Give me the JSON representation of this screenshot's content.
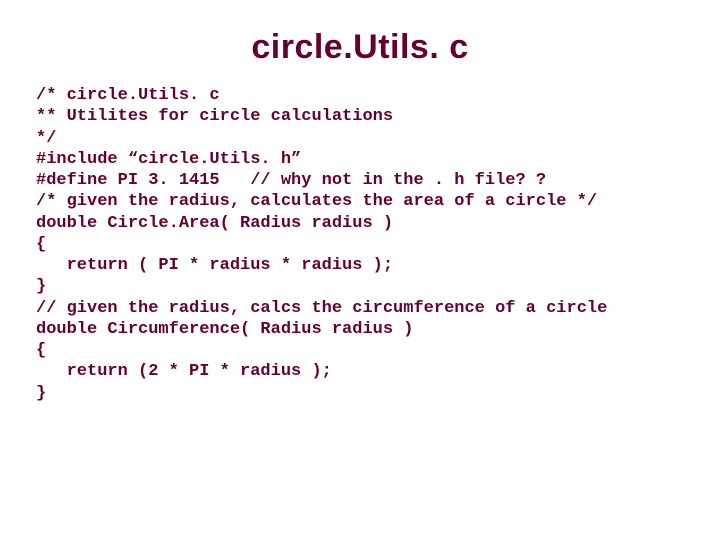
{
  "title": "circle.Utils. c",
  "code_block_1": "/* circle.Utils. c\n** Utilites for circle calculations\n*/\n#include “circle.Utils. h”\n#define PI 3. 1415   // why not in the . h file? ?",
  "code_block_2": "/* given the radius, calculates the area of a circle */\ndouble Circle.Area( Radius radius )\n{\n   return ( PI * radius * radius );\n}",
  "code_block_3": "// given the radius, calcs the circumference of a circle\ndouble Circumference( Radius radius )\n{\n   return (2 * PI * radius );\n}"
}
